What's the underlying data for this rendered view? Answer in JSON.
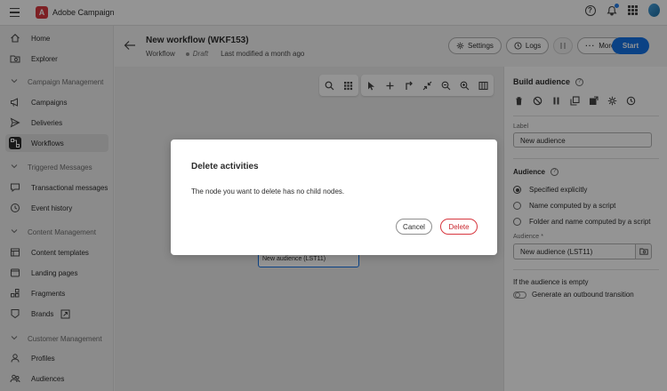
{
  "app": {
    "name": "Adobe Campaign"
  },
  "colors": {
    "accent": "#1473e6",
    "brand": "#d7373f",
    "danger": "#c9252d"
  },
  "topbar": {
    "icons": [
      "help-icon",
      "bell-icon",
      "apps-icon",
      "avatar"
    ]
  },
  "sidebar": {
    "items": [
      {
        "label": "Home",
        "icon": "home-icon"
      },
      {
        "label": "Explorer",
        "icon": "folder-search-icon"
      },
      {
        "section": "Campaign Management"
      },
      {
        "label": "Campaigns",
        "icon": "megaphone-icon"
      },
      {
        "label": "Deliveries",
        "icon": "send-icon"
      },
      {
        "label": "Workflows",
        "icon": "workflow-icon",
        "active": true
      },
      {
        "section": "Triggered Messages"
      },
      {
        "label": "Transactional messages",
        "icon": "message-icon"
      },
      {
        "label": "Event history",
        "icon": "history-icon"
      },
      {
        "section": "Content Management"
      },
      {
        "label": "Content templates",
        "icon": "template-icon"
      },
      {
        "label": "Landing pages",
        "icon": "web-page-icon"
      },
      {
        "label": "Fragments",
        "icon": "fragments-icon"
      },
      {
        "label": "Brands",
        "icon": "brand-icon"
      },
      {
        "section": "Customer Management"
      },
      {
        "label": "Profiles",
        "icon": "user-icon"
      },
      {
        "label": "Audiences",
        "icon": "users-icon"
      }
    ]
  },
  "header": {
    "title": "New workflow (WKF153)",
    "type": "Workflow",
    "status": "Draft",
    "modified": "Last modified a month ago",
    "settings_label": "Settings",
    "logs_label": "Logs",
    "more_label": "More",
    "start_label": "Start"
  },
  "canvas": {
    "toolbar": [
      "search-icon",
      "grid-icon",
      "pointer-icon",
      "add-icon",
      "branch-icon",
      "collapse-icon",
      "zoom-out-icon",
      "zoom-in-icon",
      "map-icon"
    ],
    "node_label": "New audience (LST11)"
  },
  "panel": {
    "title": "Build audience",
    "label_field": {
      "label": "Label",
      "value": "New audience"
    },
    "audience": {
      "title": "Audience",
      "options": [
        {
          "label": "Specified explicitly",
          "checked": true
        },
        {
          "label": "Name computed by a script",
          "checked": false
        },
        {
          "label": "Folder and name computed by a script",
          "checked": false
        }
      ],
      "field_label": "Audience",
      "required_mark": "*",
      "value": "New audience (LST11)"
    },
    "empty_label": "If the audience is empty",
    "toggle_label": "Generate an outbound transition"
  },
  "dialog": {
    "title": "Delete activities",
    "body": "The node you want to delete has no child nodes.",
    "cancel_label": "Cancel",
    "delete_label": "Delete"
  }
}
